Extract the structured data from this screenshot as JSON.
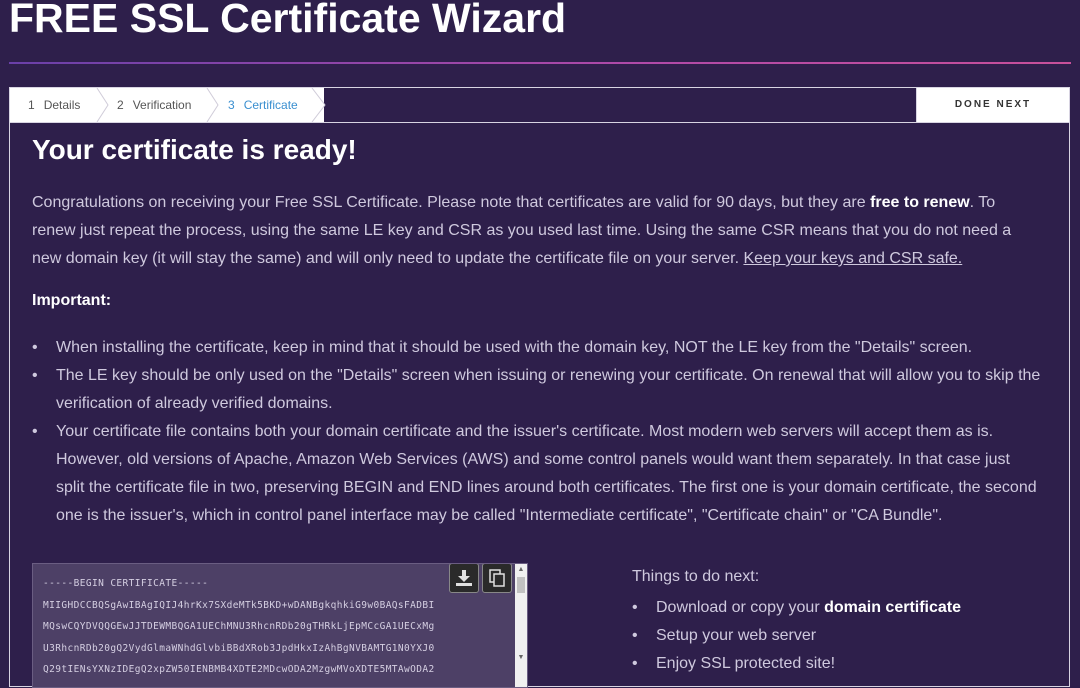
{
  "header": {
    "title": "FREE SSL Certificate Wizard"
  },
  "steps": [
    {
      "num": "1",
      "label": "Details"
    },
    {
      "num": "2",
      "label": "Verification"
    },
    {
      "num": "3",
      "label": "Certificate"
    }
  ],
  "done_next_label": "DONE NEXT",
  "main": {
    "heading": "Your certificate is ready!",
    "intro_1": "Congratulations on receiving your Free SSL Certificate. Please note that certificates are valid for 90 days, but they are ",
    "intro_bold": "free to renew",
    "intro_2": ". To renew just repeat the process, using the same LE key and CSR as you used last time. Using the same CSR means that you do not need a new domain key (it will stay the same) and will only need to update the certificate file on your server. ",
    "intro_link": "Keep your keys and CSR safe.",
    "important_label": "Important:",
    "notes": [
      "When installing the certificate, keep in mind that it should be used with the domain key, NOT the LE key from the \"Details\" screen.",
      "The LE key should be only used on the \"Details\" screen when issuing or renewing your certificate. On renewal that will allow you to skip the verification of already verified domains.",
      "Your certificate file contains both your domain certificate and the issuer's certificate. Most modern web servers will accept them as is. However, old versions of Apache, Amazon Web Services (AWS) and some control panels would want them separately. In that case just split the certificate file in two, preserving BEGIN and END lines around both certificates. The first one is your domain certificate, the second one is the issuer's, which in control panel interface may be called \"Intermediate certificate\", \"Certificate chain\" or \"CA Bundle\"."
    ]
  },
  "certificate": {
    "text": "-----BEGIN CERTIFICATE-----\nMIIGHDCCBQSgAwIBAgIQIJ4hrKx7SXdeMTk5BKD+wDANBgkqhkiG9w0BAQsFADBI\nMQswCQYDVQQGEwJJTDEWMBQGA1UEChMNU3RhcnRDb20gTHRkLjEpMCcGA1UECxMg\nU3RhcnRDb20gQ2VydGlmaWNhdGlvbiBBdXRob3JpdHkxIzAhBgNVBAMTG1N0YXJ0\nQ29tIENsYXNzIDEgQ2xpZW50IENBMB4XDTE2MDcwODA2MzgwMVoXDTE5MTAwODA2",
    "download_icon": "download-icon",
    "copy_icon": "copy-icon"
  },
  "todo": {
    "title": "Things to do next:",
    "item1_prefix": "Download or copy your ",
    "item1_bold": "domain certificate",
    "item2": "Setup your web server",
    "item3": "Enjoy SSL protected site!"
  }
}
